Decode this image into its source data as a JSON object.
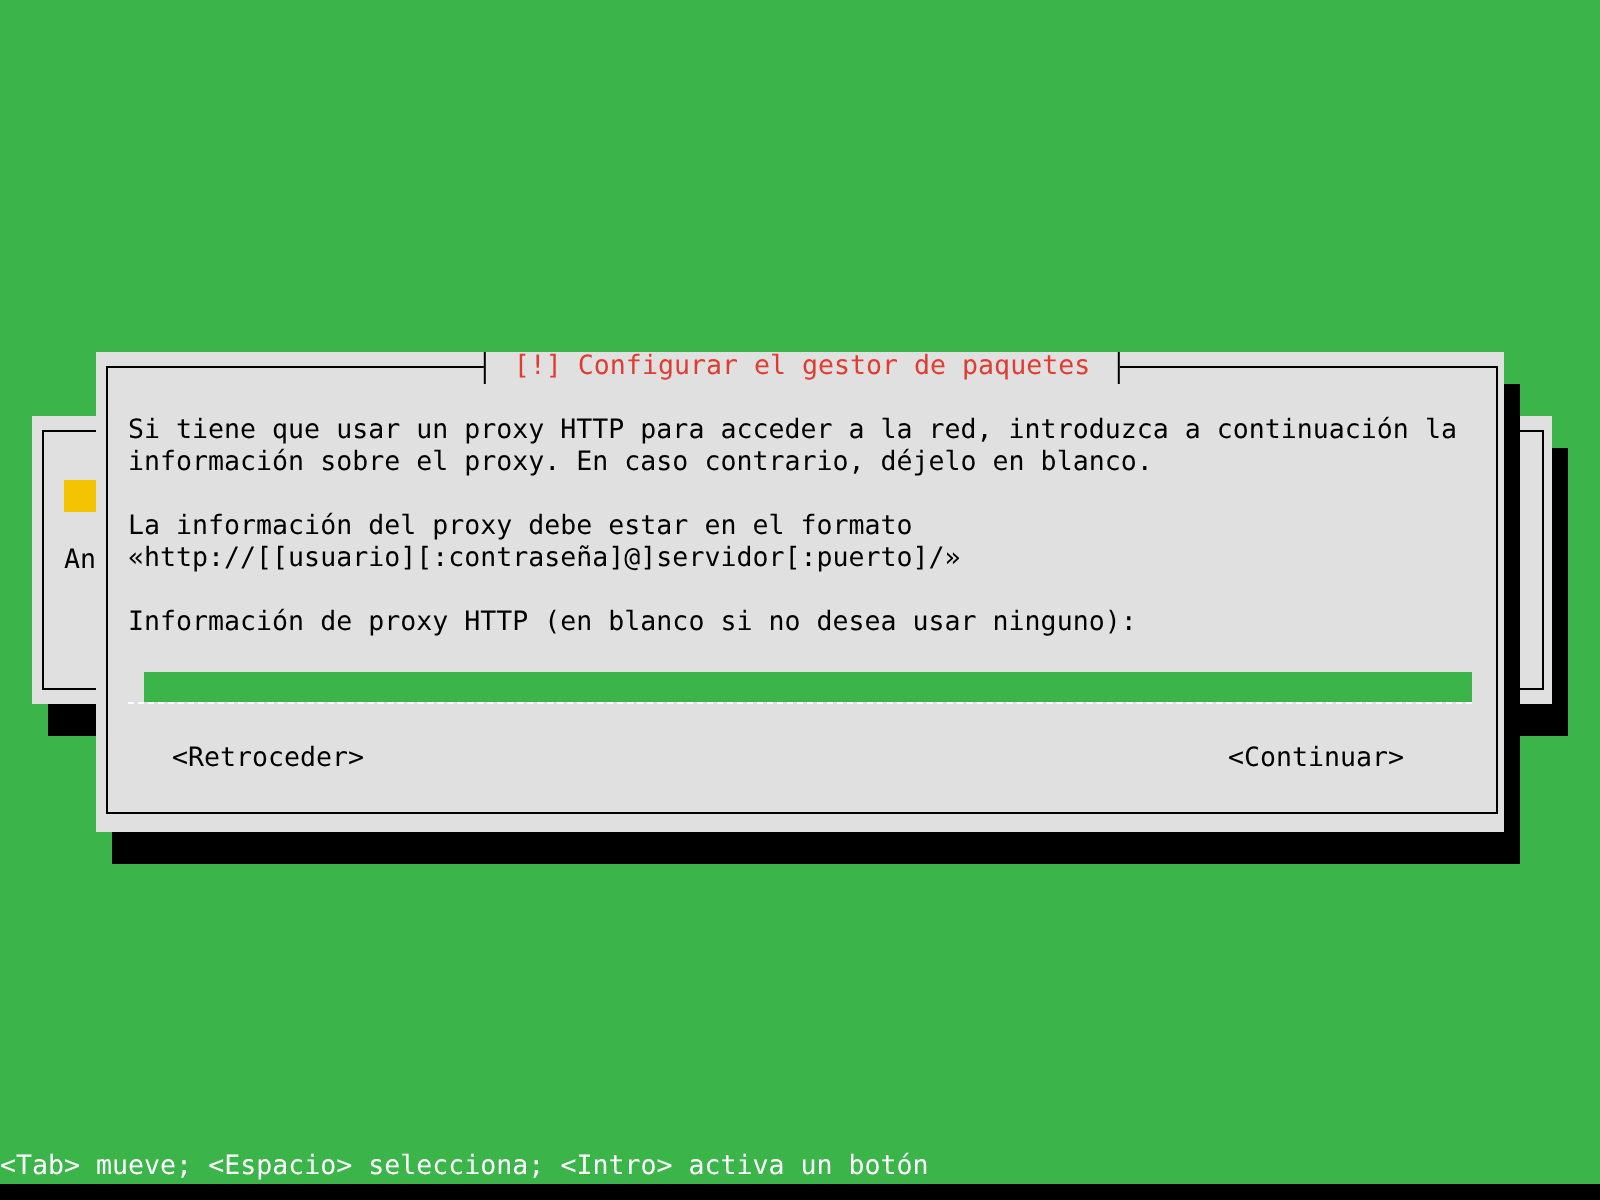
{
  "background_dialog": {
    "text": "An"
  },
  "dialog": {
    "title": "[!] Configurar el gestor de paquetes",
    "paragraphs": [
      [
        "Si tiene que usar un proxy HTTP para acceder a la red, introduzca a continuación la",
        "información sobre el proxy. En caso contrario, déjelo en blanco."
      ],
      [
        "La información del proxy debe estar en el formato",
        "«http://[[usuario][:contraseña]@]servidor[:puerto]/»"
      ],
      [
        "Información de proxy HTTP (en blanco si no desea usar ninguno):"
      ]
    ],
    "buttons": [
      {
        "label": "<Retroceder>",
        "selected": false
      },
      {
        "label": "<Continuar>",
        "selected": false
      }
    ]
  },
  "status_bar": "<Tab> mueve; <Espacio> selecciona; <Intro> activa un botón"
}
